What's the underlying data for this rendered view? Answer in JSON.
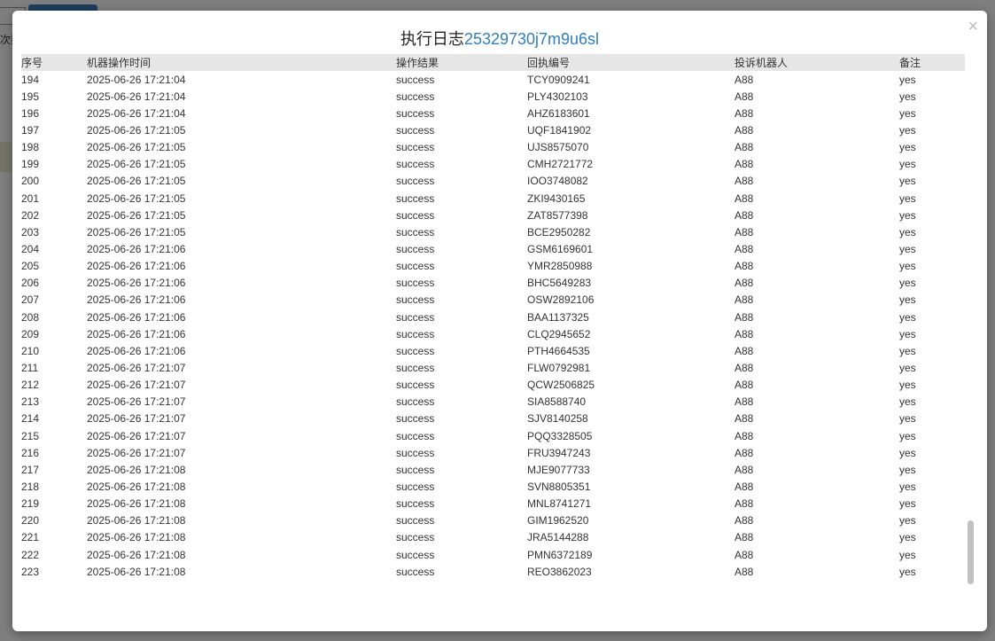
{
  "modal": {
    "title_prefix": "执行日志",
    "title_id": "25329730j7m9u6sl",
    "close_symbol": "×"
  },
  "background": {
    "partial_label": "次数"
  },
  "table": {
    "headers": [
      "序号",
      "机器操作时间",
      "操作结果",
      "回执编号",
      "投诉机器人",
      "备注"
    ],
    "rows": [
      [
        "194",
        "2025-06-26 17:21:04",
        "success",
        "TCY0909241",
        "A88",
        "yes"
      ],
      [
        "195",
        "2025-06-26 17:21:04",
        "success",
        "PLY4302103",
        "A88",
        "yes"
      ],
      [
        "196",
        "2025-06-26 17:21:04",
        "success",
        "AHZ6183601",
        "A88",
        "yes"
      ],
      [
        "197",
        "2025-06-26 17:21:05",
        "success",
        "UQF1841902",
        "A88",
        "yes"
      ],
      [
        "198",
        "2025-06-26 17:21:05",
        "success",
        "UJS8575070",
        "A88",
        "yes"
      ],
      [
        "199",
        "2025-06-26 17:21:05",
        "success",
        "CMH2721772",
        "A88",
        "yes"
      ],
      [
        "200",
        "2025-06-26 17:21:05",
        "success",
        "IOO3748082",
        "A88",
        "yes"
      ],
      [
        "201",
        "2025-06-26 17:21:05",
        "success",
        "ZKI9430165",
        "A88",
        "yes"
      ],
      [
        "202",
        "2025-06-26 17:21:05",
        "success",
        "ZAT8577398",
        "A88",
        "yes"
      ],
      [
        "203",
        "2025-06-26 17:21:05",
        "success",
        "BCE2950282",
        "A88",
        "yes"
      ],
      [
        "204",
        "2025-06-26 17:21:06",
        "success",
        "GSM6169601",
        "A88",
        "yes"
      ],
      [
        "205",
        "2025-06-26 17:21:06",
        "success",
        "YMR2850988",
        "A88",
        "yes"
      ],
      [
        "206",
        "2025-06-26 17:21:06",
        "success",
        "BHC5649283",
        "A88",
        "yes"
      ],
      [
        "207",
        "2025-06-26 17:21:06",
        "success",
        "OSW2892106",
        "A88",
        "yes"
      ],
      [
        "208",
        "2025-06-26 17:21:06",
        "success",
        "BAA1137325",
        "A88",
        "yes"
      ],
      [
        "209",
        "2025-06-26 17:21:06",
        "success",
        "CLQ2945652",
        "A88",
        "yes"
      ],
      [
        "210",
        "2025-06-26 17:21:06",
        "success",
        "PTH4664535",
        "A88",
        "yes"
      ],
      [
        "211",
        "2025-06-26 17:21:07",
        "success",
        "FLW0792981",
        "A88",
        "yes"
      ],
      [
        "212",
        "2025-06-26 17:21:07",
        "success",
        "QCW2506825",
        "A88",
        "yes"
      ],
      [
        "213",
        "2025-06-26 17:21:07",
        "success",
        "SIA8588740",
        "A88",
        "yes"
      ],
      [
        "214",
        "2025-06-26 17:21:07",
        "success",
        "SJV8140258",
        "A88",
        "yes"
      ],
      [
        "215",
        "2025-06-26 17:21:07",
        "success",
        "PQQ3328505",
        "A88",
        "yes"
      ],
      [
        "216",
        "2025-06-26 17:21:07",
        "success",
        "FRU3947243",
        "A88",
        "yes"
      ],
      [
        "217",
        "2025-06-26 17:21:08",
        "success",
        "MJE9077733",
        "A88",
        "yes"
      ],
      [
        "218",
        "2025-06-26 17:21:08",
        "success",
        "SVN8805351",
        "A88",
        "yes"
      ],
      [
        "219",
        "2025-06-26 17:21:08",
        "success",
        "MNL8741271",
        "A88",
        "yes"
      ],
      [
        "220",
        "2025-06-26 17:21:08",
        "success",
        "GIM1962520",
        "A88",
        "yes"
      ],
      [
        "221",
        "2025-06-26 17:21:08",
        "success",
        "JRA5144288",
        "A88",
        "yes"
      ],
      [
        "222",
        "2025-06-26 17:21:08",
        "success",
        "PMN6372189",
        "A88",
        "yes"
      ],
      [
        "223",
        "2025-06-26 17:21:08",
        "success",
        "REO3862023",
        "A88",
        "yes"
      ]
    ]
  },
  "colors": {
    "title_id": "#2f7ec1",
    "header_bg": "#e6e6e6",
    "overlay": "rgba(0,0,0,0.5)"
  }
}
